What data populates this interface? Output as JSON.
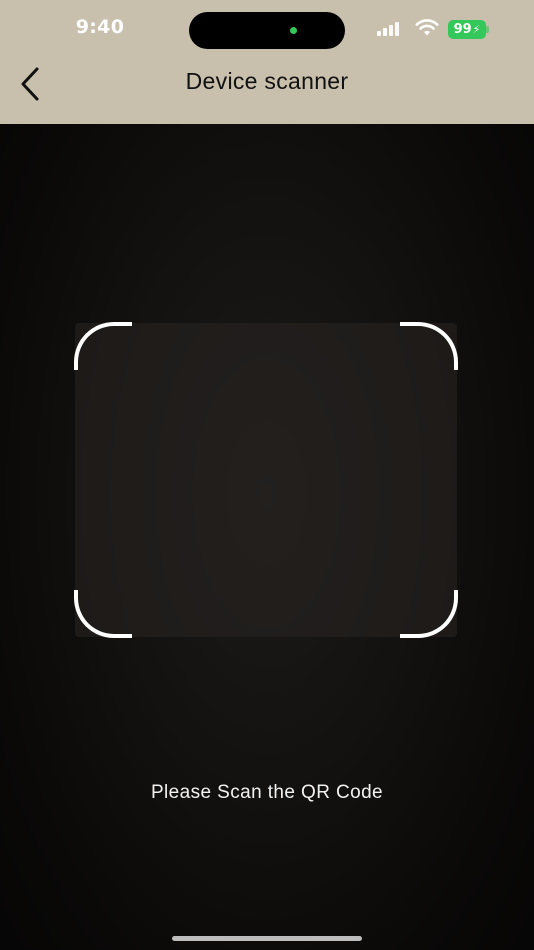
{
  "status_bar": {
    "time": "9:40",
    "battery_level": "99",
    "icons": [
      "signal-icon",
      "wifi-icon",
      "battery-icon"
    ],
    "battery_color": "#34c759"
  },
  "nav": {
    "back_icon": "chevron-left-icon",
    "title": "Device scanner"
  },
  "scanner": {
    "instruction": "Please Scan the QR Code"
  },
  "colors": {
    "header_background": "#c8bfac",
    "scanner_background": "#0b0a09",
    "frame_corners": "#ffffff"
  }
}
